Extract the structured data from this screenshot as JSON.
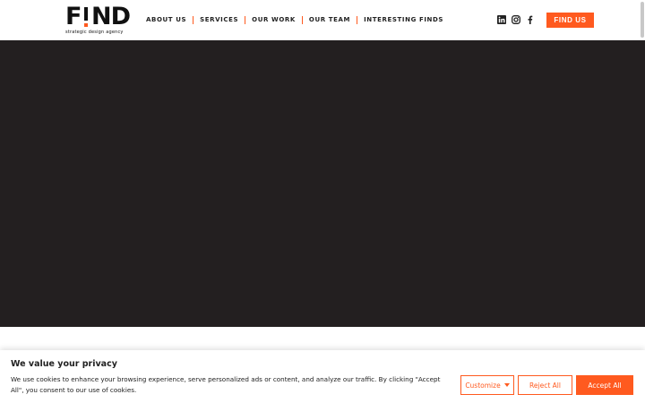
{
  "logo": {
    "mark_left": "F",
    "mark_right": "ND",
    "tagline": "strategic design agency"
  },
  "nav": {
    "items": [
      {
        "label": "ABOUT US"
      },
      {
        "label": "SERVICES"
      },
      {
        "label": "OUR WORK"
      },
      {
        "label": "OUR TEAM"
      },
      {
        "label": "INTERESTING FINDS"
      }
    ]
  },
  "social": {
    "icons": [
      "linkedin-icon",
      "instagram-icon",
      "facebook-icon"
    ]
  },
  "header": {
    "cta_label": "FIND US"
  },
  "cookie": {
    "title": "We value your privacy",
    "text": "We use cookies to enhance your browsing experience, serve personalized ads or content, and analyze our traffic. By clicking \"Accept All\", you consent to our use of cookies.",
    "customize_label": "Customize",
    "reject_label": "Reject All",
    "accept_label": "Accept All"
  },
  "colors": {
    "accent": "#ff5a1f",
    "hero_bg": "#231f20",
    "text": "#212121"
  }
}
